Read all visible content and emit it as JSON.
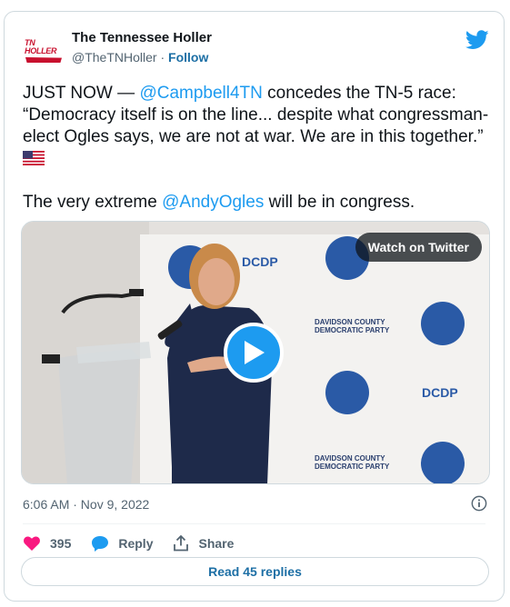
{
  "account": {
    "name": "The Tennessee Holler",
    "handle": "@TheTNHoller",
    "separator": " · ",
    "follow_label": "Follow",
    "logo_text": "TN HOLLER"
  },
  "tweet": {
    "text_part1": "JUST NOW — ",
    "mention1": "@Campbell4TN",
    "text_part2": " concedes the TN-5 race: “Democracy itself is on the line... despite what congressman-elect Ogles says, we are not at war. We are in this together.” ",
    "text_part3": "\n\nThe very extreme ",
    "mention2": "@AndyOgles",
    "text_part4": " will be in congress."
  },
  "media": {
    "watch_label": "Watch on Twitter",
    "backdrop": {
      "dcdp": "DCDP",
      "party_line1": "DAVIDSON COUNTY",
      "party_line2": "DEMOCRATIC PARTY"
    }
  },
  "timestamp": "6:06 AM · Nov 9, 2022",
  "actions": {
    "like_count": "395",
    "reply_label": "Reply",
    "share_label": "Share"
  },
  "read_replies_label": "Read 45 replies",
  "colors": {
    "accent": "#1d9bf0",
    "like": "#f91880",
    "text": "#0f1419",
    "muted": "#536471"
  }
}
